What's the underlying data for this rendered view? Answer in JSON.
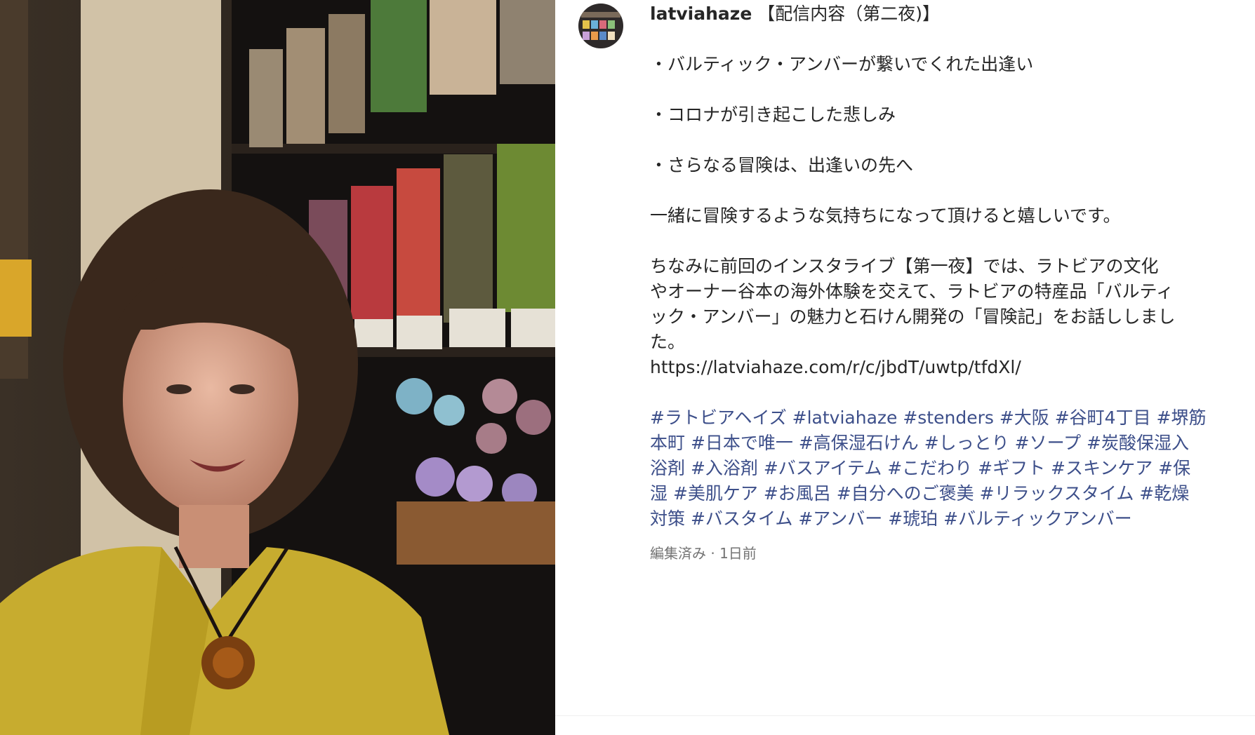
{
  "post": {
    "username": "latviahaze",
    "title": " 【配信内容（第二夜)】",
    "bullets": [
      "・バルティック・アンバーが繋いでくれた出逢い",
      "・コロナが引き起こした悲しみ",
      "・さらなる冒険は、出逢いの先へ"
    ],
    "closing": "一緒に冒険するような気持ちになって頂けると嬉しいです。",
    "paragraph_lines": [
      "ちなみに前回のインスタライブ【第一夜】では、ラトビアの文化",
      "やオーナー谷本の海外体験を交えて、ラトビアの特産品「バルティ",
      "ック・アンバー」の魅力と石けん開発の「冒険記」をお話ししまし",
      "た。"
    ],
    "link": "https://latviahaze.com/r/c/jbdT/uwtp/tfdXl/",
    "hashtag_lines": [
      "#ラトビアヘイズ #latviahaze #stenders #大阪 #谷町4丁目 #堺筋",
      "本町 #日本で唯一 #高保湿石けん #しっとり #ソープ #炭酸保湿入",
      "浴剤 #入浴剤 #バスアイテム #こだわり #ギフト #スキンケア #保",
      "湿 #美肌ケア #お風呂 #自分へのご褒美 #リラックスタイム #乾燥",
      "対策 #バスタイム #アンバー #琥珀 #バルティックアンバー"
    ],
    "edited_label": "編集済み",
    "separator": " · ",
    "time_ago": "1日前"
  },
  "colors": {
    "text": "#262626",
    "hashtag": "#3d4f8a",
    "meta": "#737373"
  }
}
